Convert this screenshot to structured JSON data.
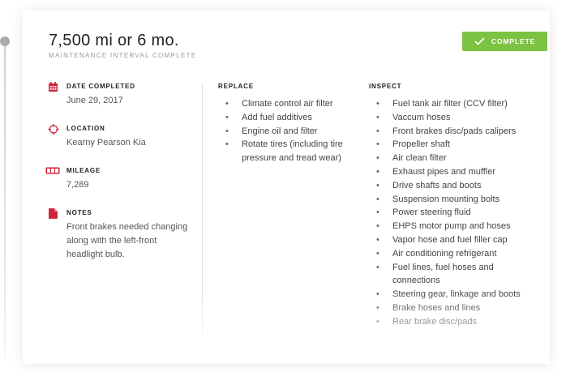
{
  "interval": {
    "title": "7,500 mi or 6 mo.",
    "subtitle": "MAINTENANCE INTERVAL COMPLETE",
    "status_button": "COMPLETE"
  },
  "details": {
    "date_completed": {
      "label": "DATE COMPLETED",
      "value": "June 29, 2017",
      "icon": "calendar-icon"
    },
    "location": {
      "label": "LOCATION",
      "value": "Kearny Pearson Kia",
      "icon": "location-target-icon"
    },
    "mileage": {
      "label": "MILEAGE",
      "value": "7,289",
      "icon": "odometer-icon"
    },
    "notes": {
      "label": "NOTES",
      "value": "Front brakes needed changing along with the left-front headlight bulb.",
      "icon": "document-icon"
    }
  },
  "replace": {
    "heading": "REPLACE",
    "items": [
      "Climate control air filter",
      "Add fuel additives",
      "Engine  oil and filter",
      "Rotate tires (including tire pressure and tread wear)"
    ]
  },
  "inspect": {
    "heading": "INSPECT",
    "items": [
      "Fuel tank air filter (CCV filter)",
      "Vaccum hoses",
      "Front brakes disc/pads calipers",
      "Propeller shaft",
      "Air clean filter",
      "Exhaust pipes and muffler",
      "Drive shafts and boots",
      "Suspension mounting bolts",
      "Power steering fluid",
      "EHPS motor pump and hoses",
      "Vapor hose and fuel filler cap",
      "Air conditioning refrigerant",
      "Fuel lines, fuel hoses and connections",
      "Steering gear, linkage and boots",
      "Brake hoses and lines",
      "Rear brake disc/pads"
    ]
  },
  "colors": {
    "accent_green": "#7cc243",
    "icon_red": "#d0243a"
  }
}
